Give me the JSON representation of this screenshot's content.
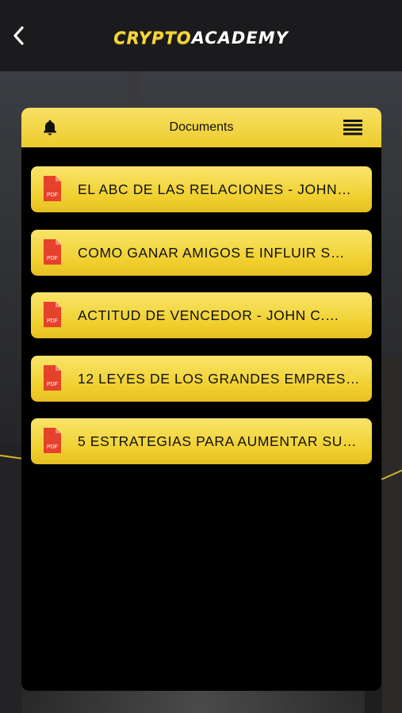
{
  "app": {
    "logo_left": "CRYPTO",
    "logo_right": "ACADEMY"
  },
  "icons": {
    "back": "chevron-left-icon",
    "bell": "bell-icon",
    "menu": "list-menu-icon",
    "pdf": "pdf-file-icon"
  },
  "panel": {
    "title": "Documents"
  },
  "documents": [
    {
      "title": "EL ABC DE LAS RELACIONES - JOHN…",
      "icon_label": "PDF"
    },
    {
      "title": "COMO GANAR AMIGOS E INFLUIR S…",
      "icon_label": "PDF"
    },
    {
      "title": "ACTITUD DE VENCEDOR - JOHN C.…",
      "icon_label": "PDF"
    },
    {
      "title": "12 LEYES DE LOS GRANDES EMPRES…",
      "icon_label": "PDF"
    },
    {
      "title": "5 ESTRATEGIAS PARA AUMENTAR SU…",
      "icon_label": "PDF"
    }
  ],
  "colors": {
    "accent": "#f2d23a",
    "topbar": "#1b1b1d",
    "panel_bg": "#000000",
    "pdf_red": "#e5412b"
  }
}
